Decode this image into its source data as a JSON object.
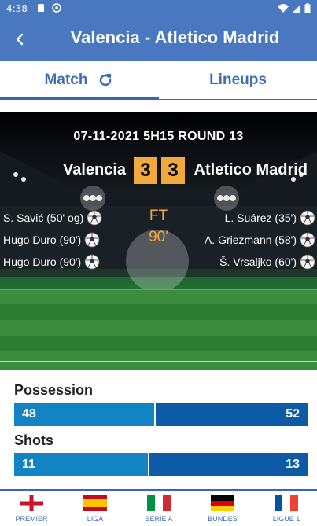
{
  "status_bar": {
    "time": "4:38"
  },
  "header": {
    "back_icon": "arrow-left-icon",
    "title": "Valencia - Atletico Madrid"
  },
  "tabs": [
    {
      "label": "Match",
      "active": true,
      "icon": "refresh-icon"
    },
    {
      "label": "Lineups",
      "active": false
    }
  ],
  "match": {
    "datetime_round": "07-11-2021 5H15 ROUND 13",
    "home_team": "Valencia",
    "away_team": "Atletico Madrid",
    "home_score": "3",
    "away_score": "3",
    "status": "FT",
    "minute": "90'",
    "home_events": [
      "S. Savić (50' og)",
      "Hugo Duro (90')",
      "Hugo Duro (90')"
    ],
    "away_events": [
      "L. Suárez (35')",
      "A. Griezmann (58')",
      "Š. Vrsaljko (60')"
    ]
  },
  "stats": [
    {
      "label": "Possession",
      "home": "48",
      "away": "52",
      "home_value": 48,
      "away_value": 52
    },
    {
      "label": "Shots",
      "home": "11",
      "away": "13",
      "home_value": 11,
      "away_value": 13
    }
  ],
  "bottom_nav": [
    {
      "label": "PREMIER",
      "flag": "england-flag-icon"
    },
    {
      "label": "LIGA",
      "flag": "spain-flag-icon"
    },
    {
      "label": "SERIE A",
      "flag": "italy-flag-icon"
    },
    {
      "label": "BUNDES",
      "flag": "germany-flag-icon"
    },
    {
      "label": "LIGUE 1",
      "flag": "france-flag-icon"
    }
  ],
  "colors": {
    "primary": "#4a78c0",
    "accent": "#f2a93b",
    "home_bar": "#1283c3",
    "away_bar": "#0d5ba7"
  }
}
